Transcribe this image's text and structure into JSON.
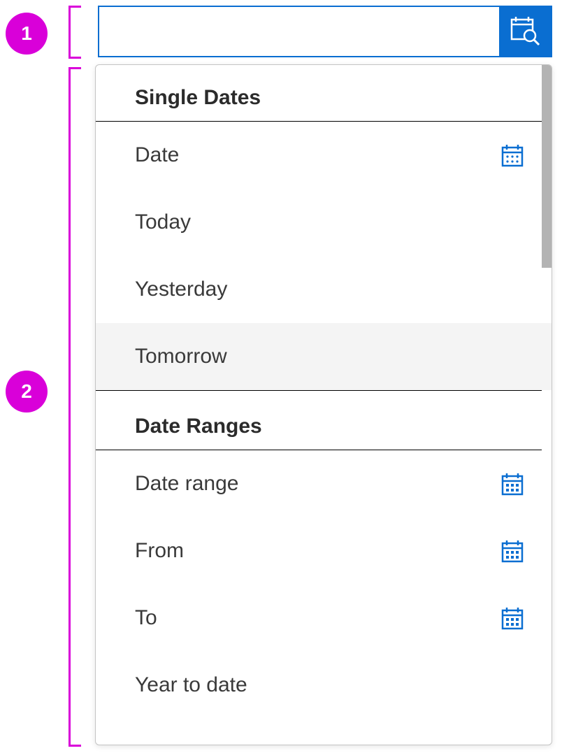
{
  "colors": {
    "accent": "#0a6ed1",
    "annotation": "#d900d9"
  },
  "annotations": {
    "badge1": "1",
    "badge2": "2"
  },
  "input": {
    "value": "",
    "placeholder": ""
  },
  "sections": [
    {
      "title": "Single Dates",
      "items": [
        {
          "label": "Date",
          "hasIcon": true,
          "iconType": "single",
          "selected": false
        },
        {
          "label": "Today",
          "hasIcon": false,
          "selected": false
        },
        {
          "label": "Yesterday",
          "hasIcon": false,
          "selected": false
        },
        {
          "label": "Tomorrow",
          "hasIcon": false,
          "selected": true
        }
      ]
    },
    {
      "title": "Date Ranges",
      "items": [
        {
          "label": "Date range",
          "hasIcon": true,
          "iconType": "range",
          "selected": false
        },
        {
          "label": "From",
          "hasIcon": true,
          "iconType": "range",
          "selected": false
        },
        {
          "label": "To",
          "hasIcon": true,
          "iconType": "range",
          "selected": false
        },
        {
          "label": "Year to date",
          "hasIcon": false,
          "selected": false
        }
      ]
    }
  ]
}
